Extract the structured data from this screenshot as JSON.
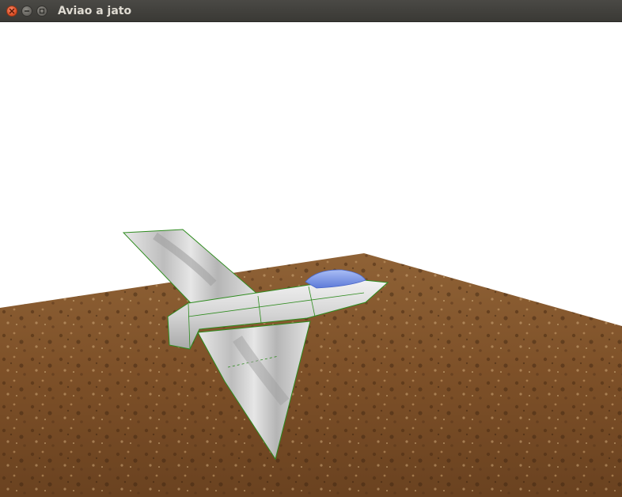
{
  "window": {
    "title": "Aviao a jato",
    "controls": {
      "close_icon": "close-icon",
      "minimize_icon": "minimize-icon",
      "maximize_icon": "maximize-icon"
    }
  },
  "scene": {
    "background_color": "#ffffff",
    "ground_color": "#8a5a2c",
    "airplane_body_color": "#d9d9d9",
    "cockpit_color": "#7b96e8",
    "wireframe_color": "#2e8b1e"
  }
}
